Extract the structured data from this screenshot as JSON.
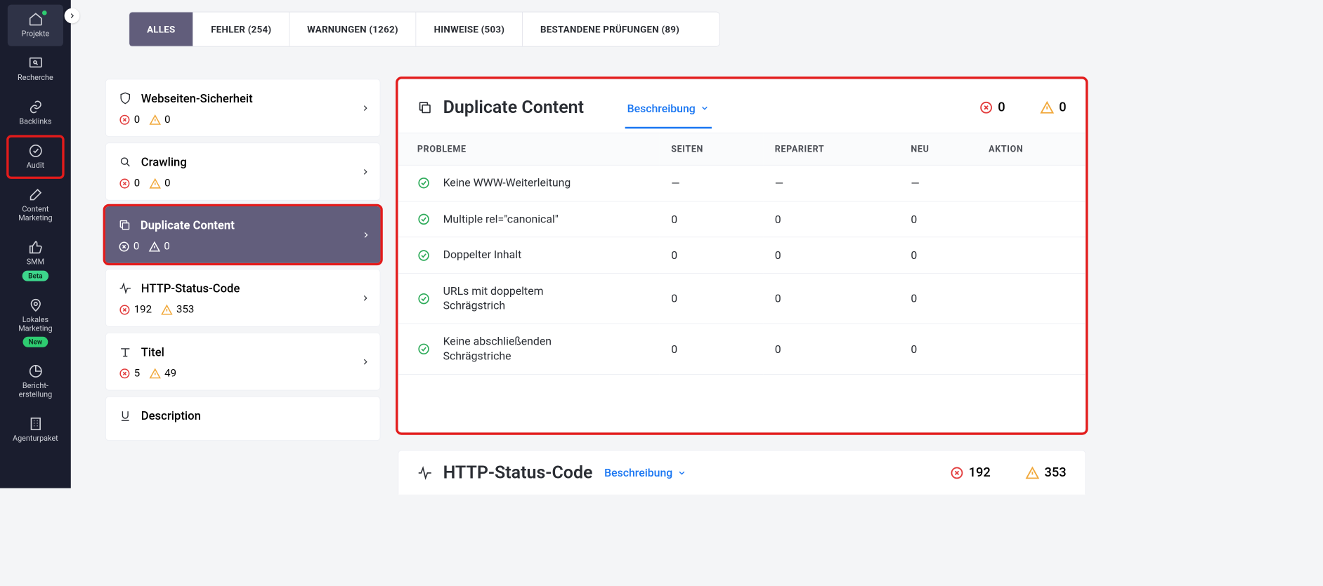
{
  "sidebar": {
    "items": [
      {
        "label": "Projekte"
      },
      {
        "label": "Recherche"
      },
      {
        "label": "Backlinks"
      },
      {
        "label": "Audit"
      },
      {
        "label": "Content Marketing"
      },
      {
        "label": "SMM",
        "badge": "Beta"
      },
      {
        "label": "Lokales Marketing",
        "badge": "New"
      },
      {
        "label": "Bericht-erstellung"
      },
      {
        "label": "Agenturpaket"
      }
    ]
  },
  "tabs": [
    {
      "label": "ALLES"
    },
    {
      "label": "FEHLER (254)"
    },
    {
      "label": "WARNUNGEN (1262)"
    },
    {
      "label": "HINWEISE (503)"
    },
    {
      "label": "BESTANDENE PRÜFUNGEN (89)"
    }
  ],
  "categories": [
    {
      "name": "Webseiten-Sicherheit",
      "errors": 0,
      "warnings": 0
    },
    {
      "name": "Crawling",
      "errors": 0,
      "warnings": 0
    },
    {
      "name": "Duplicate Content",
      "errors": 0,
      "warnings": 0,
      "selected": true
    },
    {
      "name": "HTTP-Status-Code",
      "errors": 192,
      "warnings": 353
    },
    {
      "name": "Titel",
      "errors": 5,
      "warnings": 49
    },
    {
      "name": "Description",
      "errors": null,
      "warnings": null
    }
  ],
  "detail": {
    "title": "Duplicate Content",
    "desc_label": "Beschreibung",
    "header_errors": 0,
    "header_warnings": 0,
    "columns": {
      "probleme": "PROBLEME",
      "seiten": "SEITEN",
      "repariert": "REPARIERT",
      "neu": "NEU",
      "aktion": "AKTION"
    },
    "rows": [
      {
        "problem": "Keine WWW-Weiterleitung",
        "seiten": "—",
        "repariert": "—",
        "neu": "—"
      },
      {
        "problem": "Multiple rel=\"canonical\"",
        "seiten": "0",
        "repariert": "0",
        "neu": "0"
      },
      {
        "problem": "Doppelter Inhalt",
        "seiten": "0",
        "repariert": "0",
        "neu": "0"
      },
      {
        "problem": "URLs mit doppeltem Schrägstrich",
        "seiten": "0",
        "repariert": "0",
        "neu": "0"
      },
      {
        "problem": "Keine abschließenden Schrägstriche",
        "seiten": "0",
        "repariert": "0",
        "neu": "0"
      }
    ]
  },
  "section2": {
    "title": "HTTP-Status-Code",
    "desc_label": "Beschreibung",
    "errors": 192,
    "warnings": 353
  }
}
